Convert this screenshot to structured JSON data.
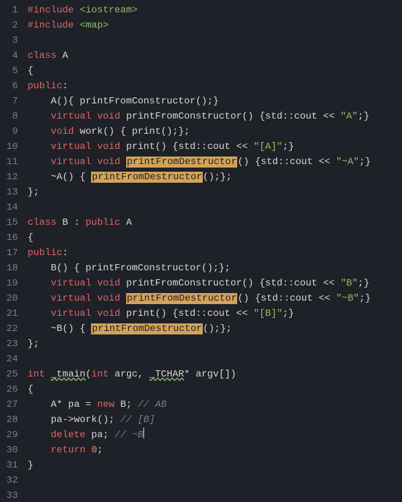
{
  "lines": [
    [
      {
        "t": "#include ",
        "c": "macro"
      },
      {
        "t": "<iostream>",
        "c": "inc"
      }
    ],
    [
      {
        "t": "#include ",
        "c": "macro"
      },
      {
        "t": "<map>",
        "c": "inc"
      }
    ],
    [],
    [
      {
        "t": "class",
        "c": "kw"
      },
      {
        "t": " A",
        "c": "cls"
      }
    ],
    [
      {
        "t": "{",
        "c": "punct"
      }
    ],
    [
      {
        "t": "public",
        "c": "kw"
      },
      {
        "t": ":",
        "c": "punct"
      }
    ],
    [
      {
        "t": "    A(){ printFromConstructor();}",
        "c": "fn"
      }
    ],
    [
      {
        "t": "    ",
        "c": "fn"
      },
      {
        "t": "virtual",
        "c": "kw"
      },
      {
        "t": " ",
        "c": "fn"
      },
      {
        "t": "void",
        "c": "kw"
      },
      {
        "t": " printFromConstructor() {std::cout << ",
        "c": "fn"
      },
      {
        "t": "\"A\"",
        "c": "str"
      },
      {
        "t": ";}",
        "c": "fn"
      }
    ],
    [
      {
        "t": "    ",
        "c": "fn"
      },
      {
        "t": "void",
        "c": "kw"
      },
      {
        "t": " work() { print();};",
        "c": "fn"
      }
    ],
    [
      {
        "t": "    ",
        "c": "fn"
      },
      {
        "t": "virtual",
        "c": "kw"
      },
      {
        "t": " ",
        "c": "fn"
      },
      {
        "t": "void",
        "c": "kw"
      },
      {
        "t": " print() {std::cout << ",
        "c": "fn"
      },
      {
        "t": "\"[A]\"",
        "c": "str"
      },
      {
        "t": ";}",
        "c": "fn"
      }
    ],
    [
      {
        "t": "    ",
        "c": "fn"
      },
      {
        "t": "virtual",
        "c": "kw"
      },
      {
        "t": " ",
        "c": "fn"
      },
      {
        "t": "void",
        "c": "kw"
      },
      {
        "t": " ",
        "c": "fn"
      },
      {
        "t": "printFromDestructor",
        "c": "hl"
      },
      {
        "t": "() {std::cout << ",
        "c": "fn"
      },
      {
        "t": "\"~A\"",
        "c": "str"
      },
      {
        "t": ";}",
        "c": "fn"
      }
    ],
    [
      {
        "t": "    ~A() { ",
        "c": "fn"
      },
      {
        "t": "printFromDestructor",
        "c": "hl"
      },
      {
        "t": "();};",
        "c": "fn"
      }
    ],
    [
      {
        "t": "};",
        "c": "punct"
      }
    ],
    [],
    [
      {
        "t": "class",
        "c": "kw"
      },
      {
        "t": " B : ",
        "c": "cls"
      },
      {
        "t": "public",
        "c": "kw"
      },
      {
        "t": " A",
        "c": "cls"
      }
    ],
    [
      {
        "t": "{",
        "c": "punct"
      }
    ],
    [
      {
        "t": "public",
        "c": "kw"
      },
      {
        "t": ":",
        "c": "punct"
      }
    ],
    [
      {
        "t": "    B() { printFromConstructor();};",
        "c": "fn"
      }
    ],
    [
      {
        "t": "    ",
        "c": "fn"
      },
      {
        "t": "virtual",
        "c": "kw"
      },
      {
        "t": " ",
        "c": "fn"
      },
      {
        "t": "void",
        "c": "kw"
      },
      {
        "t": " printFromConstructor() {std::cout << ",
        "c": "fn"
      },
      {
        "t": "\"B\"",
        "c": "str"
      },
      {
        "t": ";}",
        "c": "fn"
      }
    ],
    [
      {
        "t": "    ",
        "c": "fn"
      },
      {
        "t": "virtual",
        "c": "kw"
      },
      {
        "t": " ",
        "c": "fn"
      },
      {
        "t": "void",
        "c": "kw"
      },
      {
        "t": " ",
        "c": "fn"
      },
      {
        "t": "printFromDestructor",
        "c": "hl"
      },
      {
        "t": "() {std::cout << ",
        "c": "fn"
      },
      {
        "t": "\"~B\"",
        "c": "str"
      },
      {
        "t": ";}",
        "c": "fn"
      }
    ],
    [
      {
        "t": "    ",
        "c": "fn"
      },
      {
        "t": "virtual",
        "c": "kw"
      },
      {
        "t": " ",
        "c": "fn"
      },
      {
        "t": "void",
        "c": "kw"
      },
      {
        "t": " print() {std::cout << ",
        "c": "fn"
      },
      {
        "t": "\"[B]\"",
        "c": "str"
      },
      {
        "t": ";}",
        "c": "fn"
      }
    ],
    [
      {
        "t": "    ~B() { ",
        "c": "fn"
      },
      {
        "t": "printFromDestructor",
        "c": "hl"
      },
      {
        "t": "();};",
        "c": "fn"
      }
    ],
    [
      {
        "t": "};",
        "c": "punct"
      }
    ],
    [],
    [
      {
        "t": "int",
        "c": "kw"
      },
      {
        "t": " ",
        "c": "fn"
      },
      {
        "t": "_tmain",
        "c": "fn",
        "u": true
      },
      {
        "t": "(",
        "c": "fn"
      },
      {
        "t": "int",
        "c": "kw"
      },
      {
        "t": " argc, ",
        "c": "fn"
      },
      {
        "t": "_TCHAR",
        "c": "fn",
        "u": true
      },
      {
        "t": "* argv[])",
        "c": "fn"
      }
    ],
    [
      {
        "t": "{",
        "c": "punct"
      }
    ],
    [
      {
        "t": "    A* pa = ",
        "c": "fn"
      },
      {
        "t": "new",
        "c": "kw"
      },
      {
        "t": " B; ",
        "c": "fn"
      },
      {
        "t": "// AB",
        "c": "com"
      }
    ],
    [
      {
        "t": "    pa->work(); ",
        "c": "fn"
      },
      {
        "t": "// [B]",
        "c": "com"
      }
    ],
    [
      {
        "t": "    ",
        "c": "fn"
      },
      {
        "t": "delete",
        "c": "kw"
      },
      {
        "t": " pa; ",
        "c": "fn"
      },
      {
        "t": "// ~B",
        "c": "com",
        "cur": true
      }
    ],
    [
      {
        "t": "    ",
        "c": "fn"
      },
      {
        "t": "return",
        "c": "kw"
      },
      {
        "t": " ",
        "c": "fn"
      },
      {
        "t": "0",
        "c": "num"
      },
      {
        "t": ";",
        "c": "fn"
      }
    ],
    [
      {
        "t": "}",
        "c": "punct"
      }
    ],
    [],
    []
  ]
}
